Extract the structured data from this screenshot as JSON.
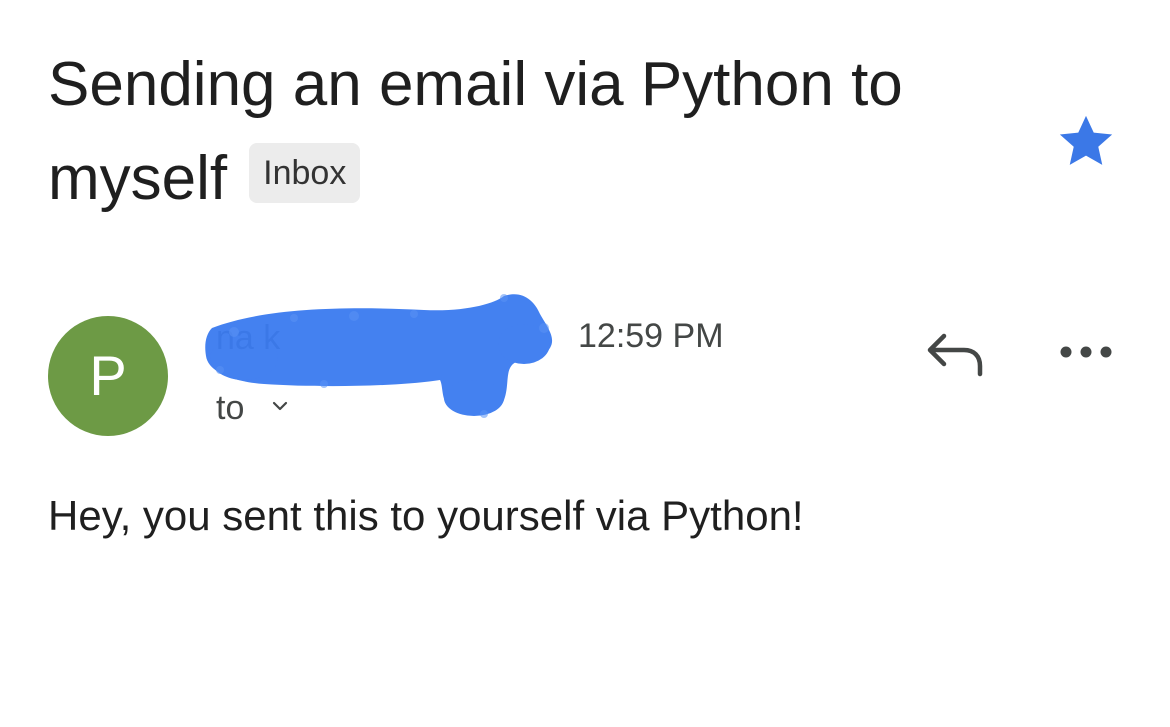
{
  "email": {
    "subject": "Sending an email via Python to myself",
    "label": "Inbox",
    "starred": true,
    "sender": {
      "avatar_letter": "P",
      "avatar_color": "#6d9a45",
      "name_visible_fragment": "na k",
      "name_redacted": true,
      "redaction_color": "#3b7bf0"
    },
    "time": "12:59 PM",
    "recipients_label": "to",
    "body": "Hey, you sent this to yourself via Python!"
  },
  "icons": {
    "star": "star-icon",
    "reply": "reply-icon",
    "more": "more-options-icon",
    "expand": "chevron-down-icon"
  },
  "colors": {
    "star": "#3b78e7",
    "text": "#1f1f1f",
    "secondary_text": "#444746",
    "chip_bg": "#ececec"
  }
}
